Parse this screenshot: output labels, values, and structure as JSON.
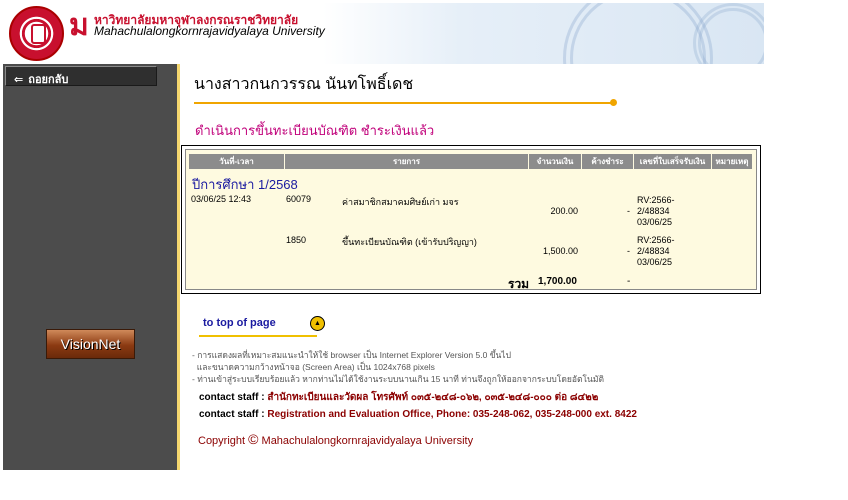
{
  "header": {
    "logo_letter": "ม",
    "thai_name": "หาวิทยาลัยมหาจุฬาลงกรณราชวิทยาลัย",
    "eng_name": "Mahachulalongkornrajavidyalaya University"
  },
  "sidebar": {
    "back_label": "ถอยกลับ",
    "visionnet_label": "VisionNet"
  },
  "student": {
    "name": "นางสาวกนกวรรณ นันทโพธิ์เดช"
  },
  "status_text": "ดำเนินการขึ้นทะเบียนบัณฑิต ชำระเงินแล้ว",
  "table": {
    "headers": [
      "วันที่-เวลา",
      "รายการ",
      "จำนวนเงิน",
      "ค้างชำระ",
      "เลขที่ใบเสร็จรับเงิน",
      "หมายเหตุ"
    ],
    "academic_year": "ปีการศึกษา 1/2568",
    "rows": [
      {
        "datetime": "03/06/25 12:43",
        "code": "60079",
        "item": "ค่าสมาชิกสมาคมศิษย์เก่า มจร",
        "amount": "200.00",
        "outstanding": "-",
        "receipt_line1": "RV:2566-",
        "receipt_line2": "2/48834",
        "receipt_line3": "03/06/25"
      },
      {
        "datetime": "",
        "code": "1850",
        "item": "ขึ้นทะเบียนบัณฑิต (เข้ารับปริญญา)",
        "amount": "1,500.00",
        "outstanding": "-",
        "receipt_line1": "RV:2566-",
        "receipt_line2": "2/48834",
        "receipt_line3": "03/06/25"
      }
    ],
    "total_label": "รวม",
    "total_amount": "1,700.00",
    "total_outstanding": "-"
  },
  "to_top_label": "to top of page",
  "notes": {
    "line1": "- การแสดงผลที่เหมาะสมแนะนำให้ใช้ browser เป็น Internet Explorer Version 5.0 ขึ้นไป",
    "line2": "  และขนาดความกว้างหน้าจอ (Screen Area) เป็น 1024x768 pixels",
    "line3": "- ท่านเข้าสู่ระบบเรียบร้อยแล้ว หากท่านไม่ได้ใช้งานระบบนานเกิน 15 นาที ท่านจึงถูกให้ออกจากระบบโดยอัตโนมัติ"
  },
  "contact_th": {
    "label": "contact staff :",
    "value": "สำนักทะเบียนและวัดผล โทรศัพท์ ๐๓๕-๒๔๘-๐๖๒, ๐๓๕-๒๔๘-๐๐๐ ต่อ ๘๔๒๒"
  },
  "contact_en": {
    "label": "contact staff :",
    "value": "Registration and Evaluation Office, Phone: 035-248-062, 035-248-000 ext. 8422"
  },
  "copyright": {
    "word": "Copyright",
    "symbol": "©",
    "holder": "Mahachulalongkornrajavidyalaya University"
  }
}
